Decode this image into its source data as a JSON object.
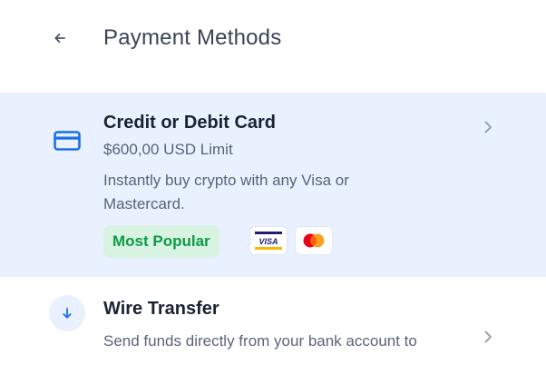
{
  "header": {
    "title": "Payment Methods",
    "back_icon": "arrow-left-icon"
  },
  "methods": [
    {
      "title": "Credit or Debit Card",
      "limit": "$600,00 USD Limit",
      "description": "Instantly buy crypto with any Visa or Mastercard.",
      "badge": "Most Popular",
      "icon": "credit-card-icon",
      "logos": [
        "visa-logo",
        "mastercard-logo"
      ],
      "selected": true
    },
    {
      "title": "Wire Transfer",
      "description": "Send funds directly from your bank account to",
      "icon": "arrow-down-icon",
      "selected": false
    }
  ],
  "logos": {
    "visa_text": "VISA"
  },
  "colors": {
    "selected_bg": "#e8f1fd",
    "accent_blue": "#1a6fe6",
    "badge_bg": "#d9f3e3",
    "badge_text": "#0e9a45",
    "visa_blue": "#1a1f71",
    "visa_gold": "#f7b600",
    "mc_red": "#eb001b",
    "mc_orange": "#f79e1b"
  }
}
